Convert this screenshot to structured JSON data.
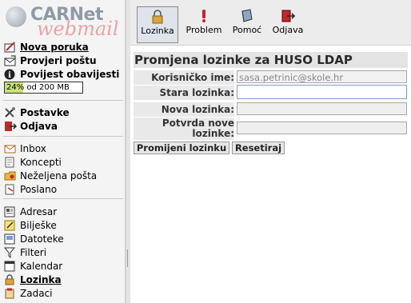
{
  "logo": {
    "brand": "CARNet",
    "sub": "webmail"
  },
  "sidebar": {
    "top_items": [
      {
        "label": "Nova poruka",
        "icon": "new-message-icon",
        "underline_first": true
      },
      {
        "label": "Provjeri poštu",
        "icon": "check-mail-icon",
        "underline_first": true
      },
      {
        "label": "Povijest obavijesti",
        "icon": "info-icon"
      }
    ],
    "quota": {
      "text": "24% od 200 MB",
      "percent": 24
    },
    "settings_items": [
      {
        "label": "Postavke",
        "icon": "settings-tools-icon"
      },
      {
        "label": "Odjava",
        "icon": "logout-icon"
      }
    ],
    "folders": [
      {
        "label": "Inbox",
        "icon": "inbox-icon"
      },
      {
        "label": "Koncepti",
        "icon": "drafts-icon"
      },
      {
        "label": "Neželjena pošta",
        "icon": "spam-folder-icon"
      },
      {
        "label": "Poslano",
        "icon": "sent-icon"
      }
    ],
    "tools": [
      {
        "label": "Adresar",
        "icon": "address-book-icon"
      },
      {
        "label": "Bilješke",
        "icon": "notes-icon"
      },
      {
        "label": "Datoteke",
        "icon": "files-icon"
      },
      {
        "label": "Filteri",
        "icon": "filter-icon"
      },
      {
        "label": "Kalendar",
        "icon": "calendar-icon"
      },
      {
        "label": "Lozinka",
        "icon": "lock-icon",
        "active": true
      },
      {
        "label": "Zadaci",
        "icon": "tasks-icon"
      }
    ]
  },
  "toolbar": {
    "items": [
      {
        "label": "Lozinka",
        "icon": "lock-icon",
        "active": true
      },
      {
        "label": "Problem",
        "icon": "problem-icon"
      },
      {
        "label": "Pomoć",
        "icon": "help-book-icon"
      },
      {
        "label": "Odjava",
        "icon": "logout-icon"
      }
    ]
  },
  "form": {
    "title": "Promjena lozinke za HUSO LDAP",
    "username_label": "Korisničko ime:",
    "username_value": "sasa.petrinic@skole.hr",
    "old_label": "Stara lozinka:",
    "new_label": "Nova lozinka:",
    "confirm_label_line1": "Potvrda nove",
    "confirm_label_line2": "lozinke:",
    "change_button": "Promijeni lozinku",
    "reset_button": "Resetiraj"
  },
  "colors": {
    "quota_fill": "#c9e27a",
    "accent_red": "#c0272d"
  }
}
